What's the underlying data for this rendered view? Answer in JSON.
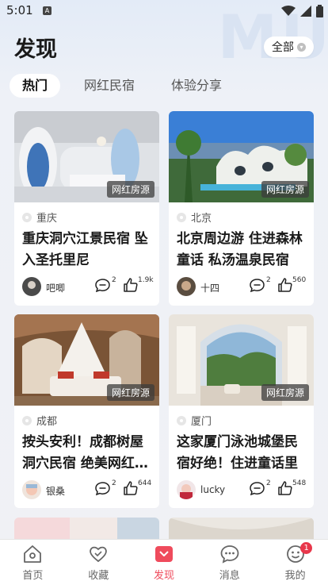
{
  "status_bar": {
    "time": "5:01",
    "sim_label": "A"
  },
  "watermark": "MU",
  "header": {
    "title": "发现",
    "filter_label": "全部",
    "filter_icon": "chevron-down-icon"
  },
  "tabs": [
    {
      "label": "热门",
      "active": true
    },
    {
      "label": "网红民宿",
      "active": false
    },
    {
      "label": "体验分享",
      "active": false
    }
  ],
  "cards": [
    {
      "badge": "网红房源",
      "location": "重庆",
      "title": "重庆洞穴江景民宿 坠入圣托里尼",
      "user": "吧唧",
      "comments": "2",
      "likes": "1.9k"
    },
    {
      "badge": "网红房源",
      "location": "北京",
      "title": "北京周边游 住进森林童话 私汤温泉民宿",
      "user": "十四",
      "comments": "2",
      "likes": "560"
    },
    {
      "badge": "网红房源",
      "location": "成都",
      "title": "按头安利！成都树屋洞穴民宿 绝美网红…",
      "user": "银桑",
      "comments": "2",
      "likes": "644"
    },
    {
      "badge": "网红房源",
      "location": "厦门",
      "title": "这家厦门泳池城堡民宿好绝！住进童话里",
      "user": "lucky",
      "comments": "2",
      "likes": "548"
    }
  ],
  "tabbar": [
    {
      "label": "首页",
      "icon": "home-icon",
      "active": false
    },
    {
      "label": "收藏",
      "icon": "heart-icon",
      "active": false
    },
    {
      "label": "发现",
      "icon": "discover-icon",
      "active": true
    },
    {
      "label": "消息",
      "icon": "message-icon",
      "active": false
    },
    {
      "label": "我的",
      "icon": "profile-icon",
      "active": false,
      "badge": "1"
    }
  ],
  "colors": {
    "accent": "#ef4b5c",
    "background": "#f0f1f5"
  }
}
